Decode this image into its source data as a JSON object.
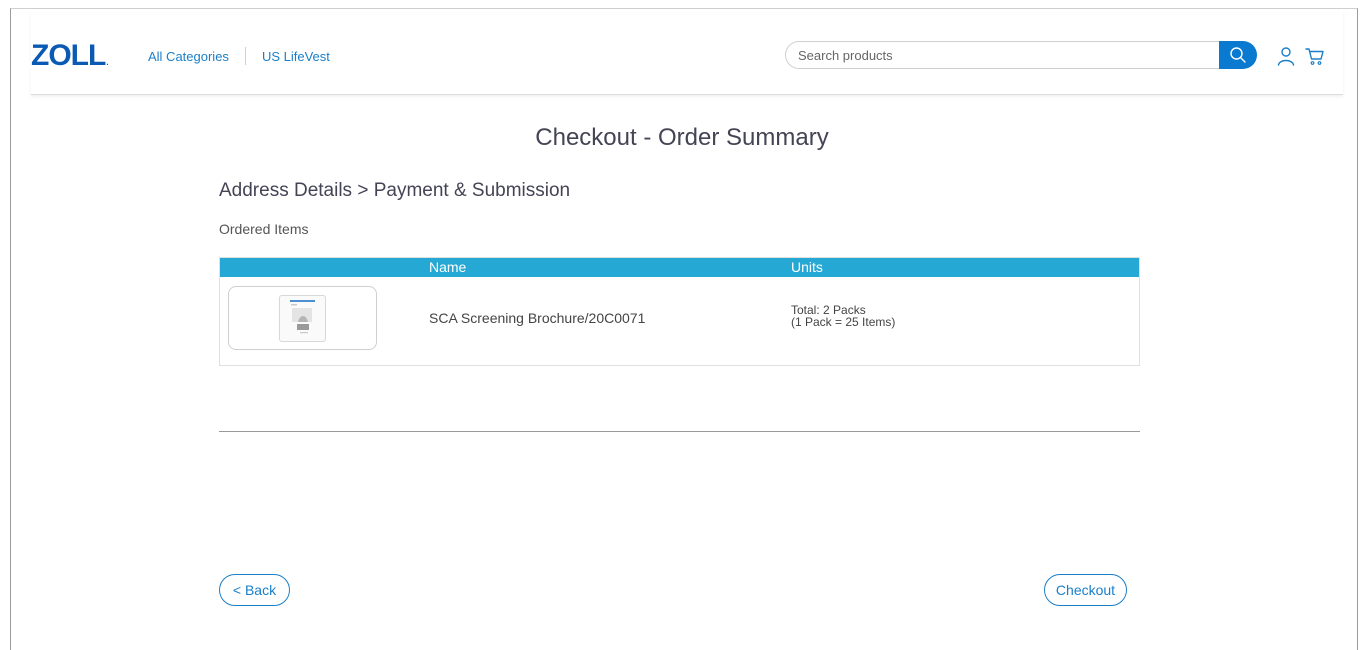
{
  "header": {
    "logo": "ZOLL",
    "nav": [
      "All Categories",
      "US LifeVest"
    ],
    "search_placeholder": "Search products",
    "icons": [
      "search-icon",
      "user-icon",
      "cart-icon"
    ]
  },
  "page": {
    "title": "Checkout - Order Summary",
    "steps": "Address Details > Payment & Submission",
    "ordered_label": "Ordered Items"
  },
  "table": {
    "headers": {
      "name": "Name",
      "units": "Units"
    },
    "rows": [
      {
        "name": "SCA Screening Brochure/20C0071",
        "units_total": "Total: 2 Packs",
        "units_pack": "(1 Pack = 25 Items)"
      }
    ]
  },
  "buttons": {
    "back": "< Back",
    "checkout": "Checkout"
  },
  "colors": {
    "brand": "#0a5ab4",
    "link": "#1a7fc8",
    "table_header": "#26a8d4"
  }
}
